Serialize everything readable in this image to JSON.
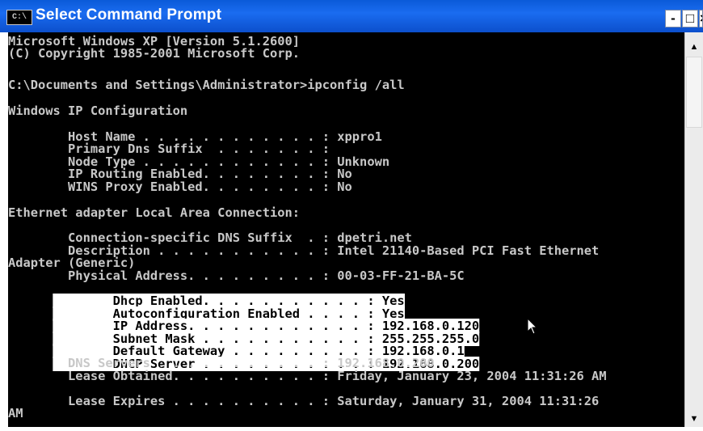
{
  "window": {
    "title": "Select Command Prompt",
    "icon_label": "C:\\",
    "controls": {
      "minimize": "-",
      "maximize": "□",
      "close": "×"
    }
  },
  "console": {
    "lines": [
      "Microsoft Windows XP [Version 5.1.2600]",
      "(C) Copyright 1985-2001 Microsoft Corp.",
      "C:\\Documents and Settings\\Administrator>ipconfig /all",
      "Windows IP Configuration",
      "        Host Name . . . . . . . . . . . . : xppro1",
      "        Primary Dns Suffix  . . . . . . . :",
      "        Node Type . . . . . . . . . . . . : Unknown",
      "        IP Routing Enabled. . . . . . . . : No",
      "        WINS Proxy Enabled. . . . . . . . : No",
      "Ethernet adapter Local Area Connection:",
      "        Connection-specific DNS Suffix  . : dpetri.net",
      "        Description . . . . . . . . . . . : Intel 21140-Based PCI Fast Ethernet",
      "Adapter (Generic)",
      "        Physical Address. . . . . . . . . : 00-03-FF-21-BA-5C",
      "        Dhcp Enabled. . . . . . . . . . . : Yes",
      "        Autoconfiguration Enabled . . . . : Yes",
      "        IP Address. . . . . . . . . . . . : 192.168.0.120",
      "        Subnet Mask . . . . . . . . . . . : 255.255.255.0",
      "        Default Gateway . . . . . . . . . : 192.168.0.1",
      "        DHCP Server . . . . . . . . . . . : 192.168.0.200",
      "        DNS Servers . . . . . . . . . . . : 192.168.0.200",
      "        Lease Obtained. . . . . . . . . . : Friday, January 23, 2004 11:31:26 AM",
      "        Lease Expires . . . . . . . . . . : Saturday, January 31, 2004 11:31:26",
      "AM"
    ]
  },
  "colors": {
    "titlebar": "#0a5ad8",
    "console_background": "#000000",
    "console_text": "#c8c8c8",
    "selection_background": "#ffffff",
    "selection_text": "#000000"
  },
  "icons": {
    "cursor": "arrow-cursor-icon",
    "scroll_up": "scroll-up-arrow-icon",
    "scroll_down": "scroll-down-arrow-icon"
  }
}
